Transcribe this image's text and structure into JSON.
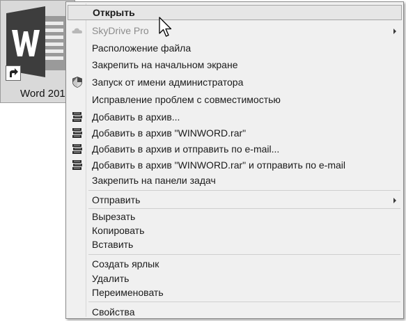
{
  "shortcut": {
    "label": "Word 201",
    "icon": "word-logo-icon"
  },
  "menu": {
    "items": [
      {
        "label": "Открыть",
        "icon": "",
        "highlighted": true,
        "disabled": false,
        "submenu": false
      },
      {
        "label": "SkyDrive Pro",
        "icon": "cloud-icon",
        "highlighted": false,
        "disabled": true,
        "submenu": true
      },
      {
        "label": "Расположение файла",
        "icon": "",
        "highlighted": false,
        "disabled": false,
        "submenu": false
      },
      {
        "label": "Закрепить на начальном экране",
        "icon": "",
        "highlighted": false,
        "disabled": false,
        "submenu": false
      },
      {
        "label": "Запуск от имени администратора",
        "icon": "uac-shield-icon",
        "highlighted": false,
        "disabled": false,
        "submenu": false
      },
      {
        "label": "Исправление проблем с совместимостью",
        "icon": "",
        "highlighted": false,
        "disabled": false,
        "submenu": false
      },
      {
        "label": "Добавить в архив...",
        "icon": "archive-books-icon",
        "highlighted": false,
        "disabled": false,
        "submenu": false
      },
      {
        "label": "Добавить в архив \"WINWORD.rar\"",
        "icon": "archive-books-icon",
        "highlighted": false,
        "disabled": false,
        "submenu": false
      },
      {
        "label": "Добавить в архив и отправить по e-mail...",
        "icon": "archive-books-icon",
        "highlighted": false,
        "disabled": false,
        "submenu": false
      },
      {
        "label": "Добавить в архив \"WINWORD.rar\" и отправить по e-mail",
        "icon": "archive-books-icon",
        "highlighted": false,
        "disabled": false,
        "submenu": false
      },
      {
        "label": "Закрепить на панели задач",
        "icon": "",
        "highlighted": false,
        "disabled": false,
        "submenu": false
      },
      {
        "label": "Отправить",
        "icon": "",
        "highlighted": false,
        "disabled": false,
        "submenu": true
      },
      {
        "label": "Вырезать",
        "icon": "",
        "highlighted": false,
        "disabled": false,
        "submenu": false
      },
      {
        "label": "Копировать",
        "icon": "",
        "highlighted": false,
        "disabled": false,
        "submenu": false
      },
      {
        "label": "Вставить",
        "icon": "",
        "highlighted": false,
        "disabled": false,
        "submenu": false
      },
      {
        "label": "Создать ярлык",
        "icon": "",
        "highlighted": false,
        "disabled": false,
        "submenu": false
      },
      {
        "label": "Удалить",
        "icon": "",
        "highlighted": false,
        "disabled": false,
        "submenu": false
      },
      {
        "label": "Переименовать",
        "icon": "",
        "highlighted": false,
        "disabled": false,
        "submenu": false
      },
      {
        "label": "Свойства",
        "icon": "",
        "highlighted": false,
        "disabled": false,
        "submenu": false
      }
    ]
  },
  "colors": {
    "menu_background": "#f0f0f0",
    "highlight_background": "#e6e6e6",
    "disabled_text": "#8c8c8c",
    "word_logo_dark": "#3d3d3d"
  },
  "cursor": "arrow-pointer-icon"
}
